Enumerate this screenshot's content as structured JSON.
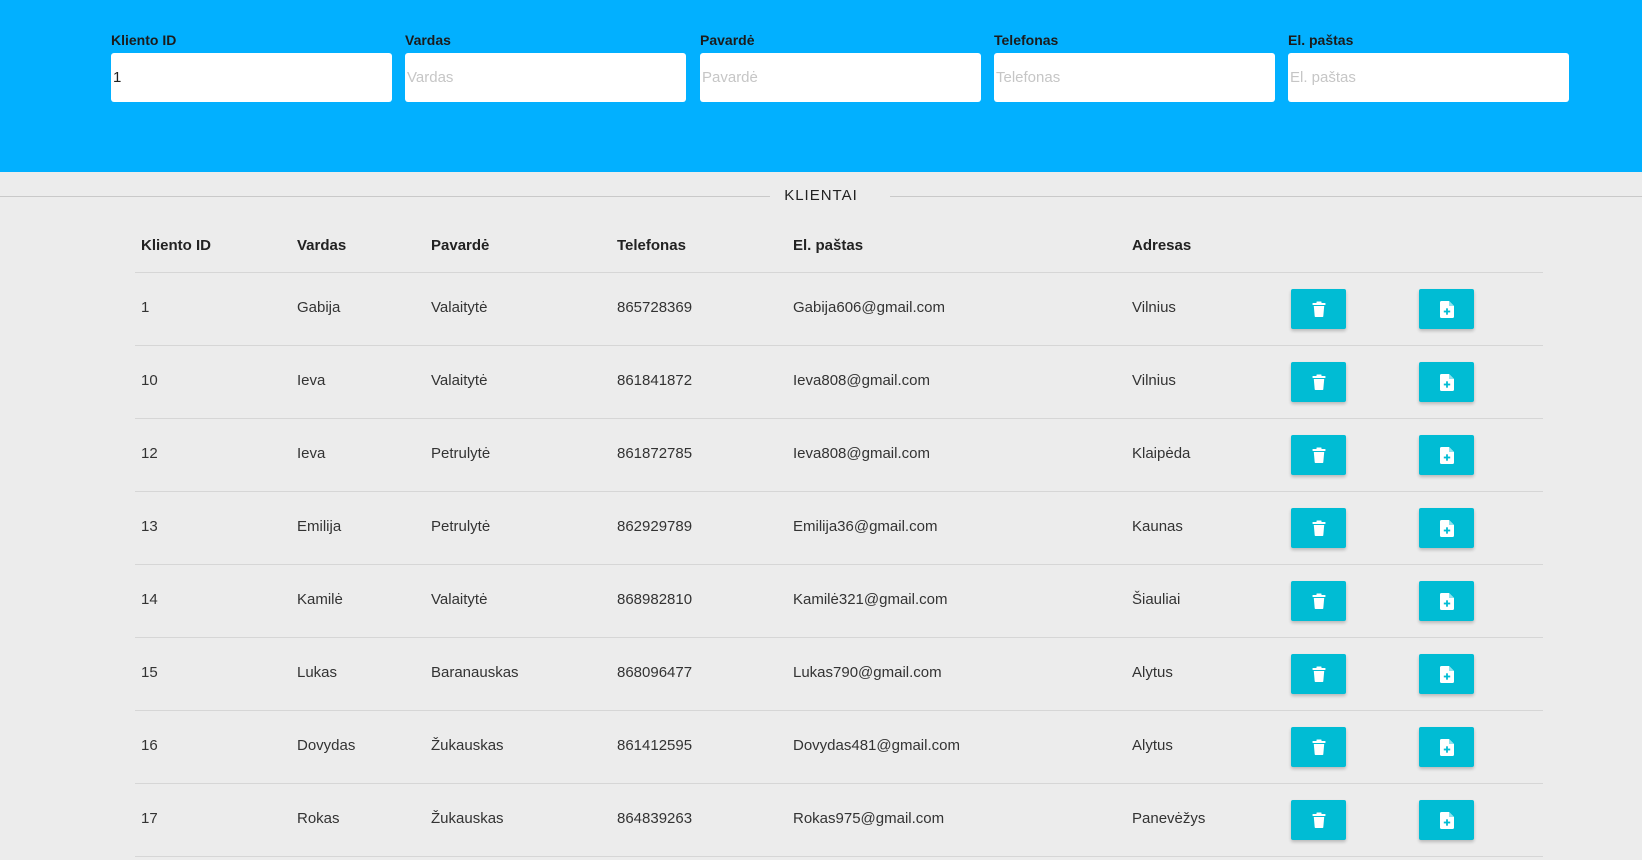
{
  "filters": [
    {
      "label": "Kliento ID",
      "value": "1",
      "placeholder": "Kliento ID"
    },
    {
      "label": "Vardas",
      "value": "",
      "placeholder": "Vardas"
    },
    {
      "label": "Pavardė",
      "value": "",
      "placeholder": "Pavardė"
    },
    {
      "label": "Telefonas",
      "value": "",
      "placeholder": "Telefonas"
    },
    {
      "label": "El. paštas",
      "value": "",
      "placeholder": "El. paštas"
    }
  ],
  "section_title": "KLIENTAI",
  "table": {
    "headers": [
      "Kliento ID",
      "Vardas",
      "Pavardė",
      "Telefonas",
      "El. paštas",
      "Adresas"
    ],
    "rows": [
      [
        "1",
        "Gabija",
        "Valaitytė",
        "865728369",
        "Gabija606@gmail.com",
        "Vilnius"
      ],
      [
        "10",
        "Ieva",
        "Valaitytė",
        "861841872",
        "Ieva808@gmail.com",
        "Vilnius"
      ],
      [
        "12",
        "Ieva",
        "Petrulytė",
        "861872785",
        "Ieva808@gmail.com",
        "Klaipėda"
      ],
      [
        "13",
        "Emilija",
        "Petrulytė",
        "862929789",
        "Emilija36@gmail.com",
        "Kaunas"
      ],
      [
        "14",
        "Kamilė",
        "Valaitytė",
        "868982810",
        "Kamilė321@gmail.com",
        "Šiauliai"
      ],
      [
        "15",
        "Lukas",
        "Baranauskas",
        "868096477",
        "Lukas790@gmail.com",
        "Alytus"
      ],
      [
        "16",
        "Dovydas",
        "Žukauskas",
        "861412595",
        "Dovydas481@gmail.com",
        "Alytus"
      ],
      [
        "17",
        "Rokas",
        "Žukauskas",
        "864839263",
        "Rokas975@gmail.com",
        "Panevėžys"
      ]
    ],
    "row_actions": {
      "delete_icon": "trash-icon",
      "edit_icon": "file-plus-icon"
    }
  },
  "colors": {
    "header_bg": "#02b0ff",
    "action_button": "#00bcd4",
    "page_bg": "#ececec"
  }
}
